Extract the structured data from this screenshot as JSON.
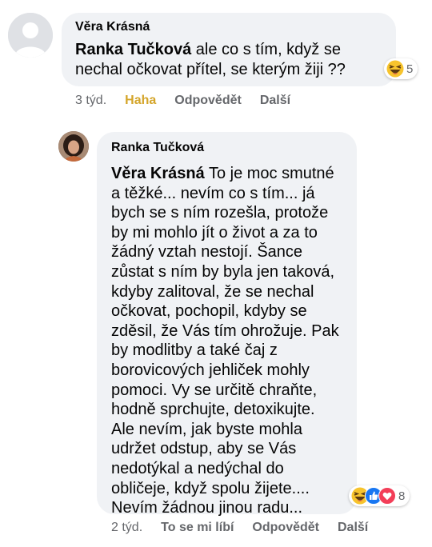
{
  "comment1": {
    "author": "Věra Krásná",
    "mention": "Ranka Tučková",
    "text": " ale co s tím, když se\nnechal očkovat přítel, se kterým žiji ??",
    "reaction_count": "5",
    "time": "3 týd.",
    "like_label": "Haha",
    "reply_label": "Odpovědět",
    "more_label": "Další"
  },
  "comment2": {
    "author": "Ranka Tučková",
    "mention": "Věra Krásná",
    "text": " To je moc smutné\na těžké... nevím co s tím... já\nbych se s ním rozešla, protože\nby mi mohlo jít o život a za to\nžádný vztah nestojí. Šance\nzůstat s ním by byla jen taková,\nkdyby zalitoval, že se nechal\nočkovat, pochopil, kdyby se\nzděsil, že Vás tím ohrožuje. Pak\nby modlitby a také čaj z\nborovicových jehliček mohly\npomoci. Vy se určitě chraňte,\nhodně sprchujte, detoxikujte.\nAle nevím, jak byste mohla\nudržet odstup, aby se Vás\nnedotýkal a nedýchal do\nobličeje, když spolu žijete....\nNevím žádnou jinou radu...",
    "reaction_count": "8",
    "time": "2 týd.",
    "like_label": "To se mi líbí",
    "reply_label": "Odpovědět",
    "more_label": "Další"
  },
  "colors": {
    "bubble": "#f0f2f5",
    "meta_text": "#65676b",
    "haha": "#d4a52a",
    "like_blue": "#1877f2",
    "love_red": "#f33e58"
  },
  "icons": [
    "default-avatar-icon",
    "profile-photo",
    "haha-emoji-icon",
    "like-emoji-icon",
    "love-emoji-icon"
  ]
}
